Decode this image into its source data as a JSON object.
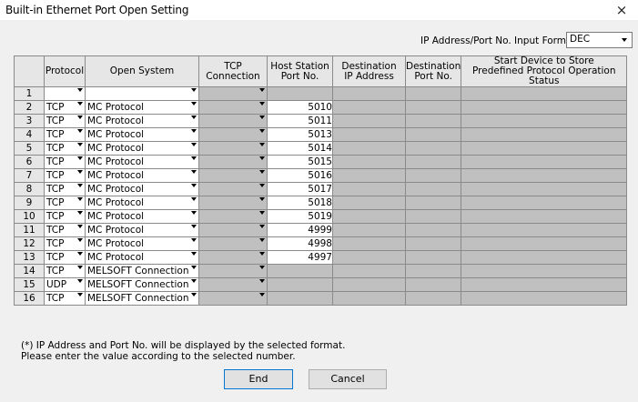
{
  "window": {
    "title": "Built-in Ethernet Port Open Setting",
    "close_glyph": "×"
  },
  "input_format": {
    "label": "IP Address/Port No. Input Format",
    "value": "DEC"
  },
  "table": {
    "headers": [
      "",
      "Protocol",
      "Open System",
      "TCP Connection",
      "Host Station\nPort No.",
      "Destination\nIP Address",
      "Destination\nPort No.",
      "Start Device to Store\nPredefined Protocol Operation Status"
    ],
    "rows": [
      {
        "no": "1",
        "protocol": "",
        "open_system": "",
        "port": ""
      },
      {
        "no": "2",
        "protocol": "TCP",
        "open_system": "MC Protocol",
        "port": "5010"
      },
      {
        "no": "3",
        "protocol": "TCP",
        "open_system": "MC Protocol",
        "port": "5011"
      },
      {
        "no": "4",
        "protocol": "TCP",
        "open_system": "MC Protocol",
        "port": "5013"
      },
      {
        "no": "5",
        "protocol": "TCP",
        "open_system": "MC Protocol",
        "port": "5014"
      },
      {
        "no": "6",
        "protocol": "TCP",
        "open_system": "MC Protocol",
        "port": "5015"
      },
      {
        "no": "7",
        "protocol": "TCP",
        "open_system": "MC Protocol",
        "port": "5016"
      },
      {
        "no": "8",
        "protocol": "TCP",
        "open_system": "MC Protocol",
        "port": "5017"
      },
      {
        "no": "9",
        "protocol": "TCP",
        "open_system": "MC Protocol",
        "port": "5018"
      },
      {
        "no": "10",
        "protocol": "TCP",
        "open_system": "MC Protocol",
        "port": "5019"
      },
      {
        "no": "11",
        "protocol": "TCP",
        "open_system": "MC Protocol",
        "port": "4999"
      },
      {
        "no": "12",
        "protocol": "TCP",
        "open_system": "MC Protocol",
        "port": "4998"
      },
      {
        "no": "13",
        "protocol": "TCP",
        "open_system": "MC Protocol",
        "port": "4997"
      },
      {
        "no": "14",
        "protocol": "TCP",
        "open_system": "MELSOFT Connection",
        "port": ""
      },
      {
        "no": "15",
        "protocol": "UDP",
        "open_system": "MELSOFT Connection",
        "port": ""
      },
      {
        "no": "16",
        "protocol": "TCP",
        "open_system": "MELSOFT Connection",
        "port": ""
      }
    ]
  },
  "note": {
    "line1": "(*) IP Address and Port No. will be displayed by the selected format.",
    "line2": "Please enter the value according to the selected number."
  },
  "buttons": {
    "end": "End",
    "cancel": "Cancel"
  }
}
